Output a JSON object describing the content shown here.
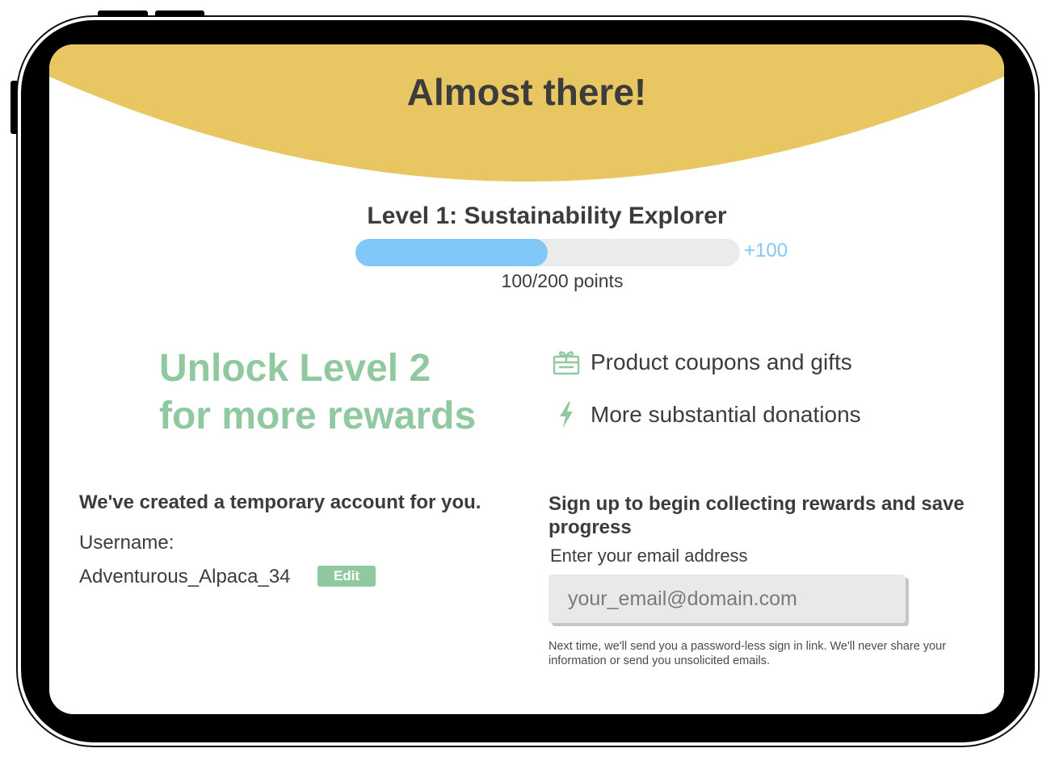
{
  "page": {
    "title": "Almost there!"
  },
  "level": {
    "title": "Level 1: Sustainability Explorer",
    "points_current": 100,
    "points_total": 200,
    "progress_fraction": 0.5,
    "bonus_label": "+100",
    "points_label": "100/200 points"
  },
  "unlock": {
    "line1": "Unlock Level 2",
    "line2": "for more rewards"
  },
  "rewards": [
    {
      "icon": "gift-icon",
      "label": "Product coupons and gifts"
    },
    {
      "icon": "lightning-icon",
      "label": "More substantial donations"
    }
  ],
  "account": {
    "heading": "We've created a temporary account for you.",
    "username_label": "Username:",
    "username": "Adventurous_Alpaca_34",
    "edit_label": "Edit"
  },
  "signup": {
    "heading": "Sign up to begin collecting rewards and save progress",
    "email_label": "Enter your email address",
    "email_value": "",
    "email_placeholder": "your_email@domain.com",
    "disclaimer": "Next time, we'll send you a password-less sign in link. We'll never share your information or send you unsolicited emails."
  },
  "colors": {
    "banner": "#E8C662",
    "progress_fill": "#7FC8F8",
    "progress_track": "#EBEBEB",
    "accent_green": "#90C9A0",
    "text_dark": "#3C3C3C"
  }
}
